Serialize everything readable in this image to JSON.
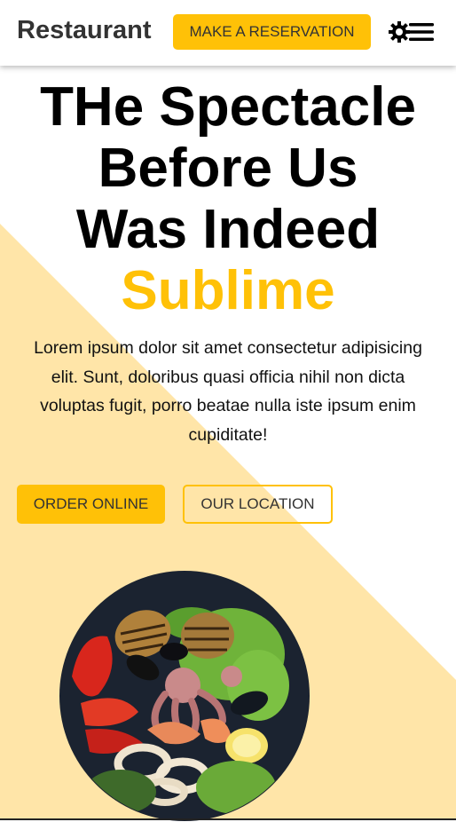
{
  "header": {
    "logo": "Restaurant",
    "reserve_label": "MAKE A RESERVATION"
  },
  "hero": {
    "title_lines": [
      "THe Spectacle",
      "Before Us",
      "Was Indeed"
    ],
    "title_accent": "Sublime",
    "description": "Lorem ipsum dolor sit amet consectetur adipisicing elit. Sunt, doloribus quasi officia nihil non dicta voluptas fugit, porro beatae nulla iste ipsum enim cupiditate!",
    "order_label": "ORDER ONLINE",
    "location_label": "OUR LOCATION"
  },
  "colors": {
    "accent": "#ffc107",
    "background_shape": "#ffe5a8",
    "text_dark": "#333333"
  },
  "icons": [
    "gear-icon",
    "menu-icon"
  ],
  "image": "seafood-dish"
}
